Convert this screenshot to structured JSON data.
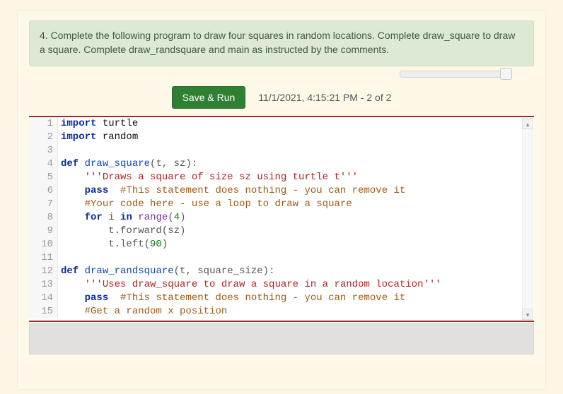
{
  "question": {
    "text": "4. Complete the following program to draw four squares in random locations. Complete draw_square to draw a square. Complete draw_randsquare and main as instructed by the comments."
  },
  "toolbar": {
    "run_label": "Save & Run",
    "timestamp": "11/1/2021, 4:15:21 PM - 2 of 2"
  },
  "code_lines": [
    {
      "n": 1,
      "tokens": [
        [
          "kw",
          "import"
        ],
        [
          "op",
          " "
        ],
        [
          "name",
          "turtle"
        ]
      ]
    },
    {
      "n": 2,
      "tokens": [
        [
          "kw",
          "import"
        ],
        [
          "op",
          " "
        ],
        [
          "name",
          "random"
        ]
      ]
    },
    {
      "n": 3,
      "tokens": []
    },
    {
      "n": 4,
      "tokens": [
        [
          "kw",
          "def"
        ],
        [
          "op",
          " "
        ],
        [
          "func",
          "draw_square"
        ],
        [
          "op",
          "(t, sz):"
        ]
      ]
    },
    {
      "n": 5,
      "tokens": [
        [
          "op",
          "    "
        ],
        [
          "str",
          "'''Draws a square of size sz using turtle t'''"
        ]
      ]
    },
    {
      "n": 6,
      "tokens": [
        [
          "op",
          "    "
        ],
        [
          "kw",
          "pass"
        ],
        [
          "op",
          "  "
        ],
        [
          "cmt",
          "#This statement does nothing - you can remove it"
        ]
      ]
    },
    {
      "n": 7,
      "tokens": [
        [
          "op",
          "    "
        ],
        [
          "cmt",
          "#Your code here - use a loop to draw a square"
        ]
      ]
    },
    {
      "n": 8,
      "tokens": [
        [
          "op",
          "    "
        ],
        [
          "kw",
          "for"
        ],
        [
          "op",
          " i "
        ],
        [
          "kw",
          "in"
        ],
        [
          "op",
          " "
        ],
        [
          "builtin",
          "range"
        ],
        [
          "op",
          "("
        ],
        [
          "num",
          "4"
        ],
        [
          "op",
          ")"
        ]
      ]
    },
    {
      "n": 9,
      "tokens": [
        [
          "op",
          "        t.forward(sz)"
        ]
      ]
    },
    {
      "n": 10,
      "tokens": [
        [
          "op",
          "        t.left("
        ],
        [
          "num",
          "90"
        ],
        [
          "op",
          ")"
        ]
      ]
    },
    {
      "n": 11,
      "tokens": []
    },
    {
      "n": 12,
      "tokens": [
        [
          "kw",
          "def"
        ],
        [
          "op",
          " "
        ],
        [
          "func",
          "draw_randsquare"
        ],
        [
          "op",
          "(t, square_size):"
        ]
      ]
    },
    {
      "n": 13,
      "tokens": [
        [
          "op",
          "    "
        ],
        [
          "str",
          "'''Uses draw_square to draw a square in a random location'''"
        ]
      ]
    },
    {
      "n": 14,
      "tokens": [
        [
          "op",
          "    "
        ],
        [
          "kw",
          "pass"
        ],
        [
          "op",
          "  "
        ],
        [
          "cmt",
          "#This statement does nothing - you can remove it"
        ]
      ]
    },
    {
      "n": 15,
      "tokens": [
        [
          "op",
          "    "
        ],
        [
          "cmt",
          "#Get a random x position"
        ]
      ]
    }
  ]
}
